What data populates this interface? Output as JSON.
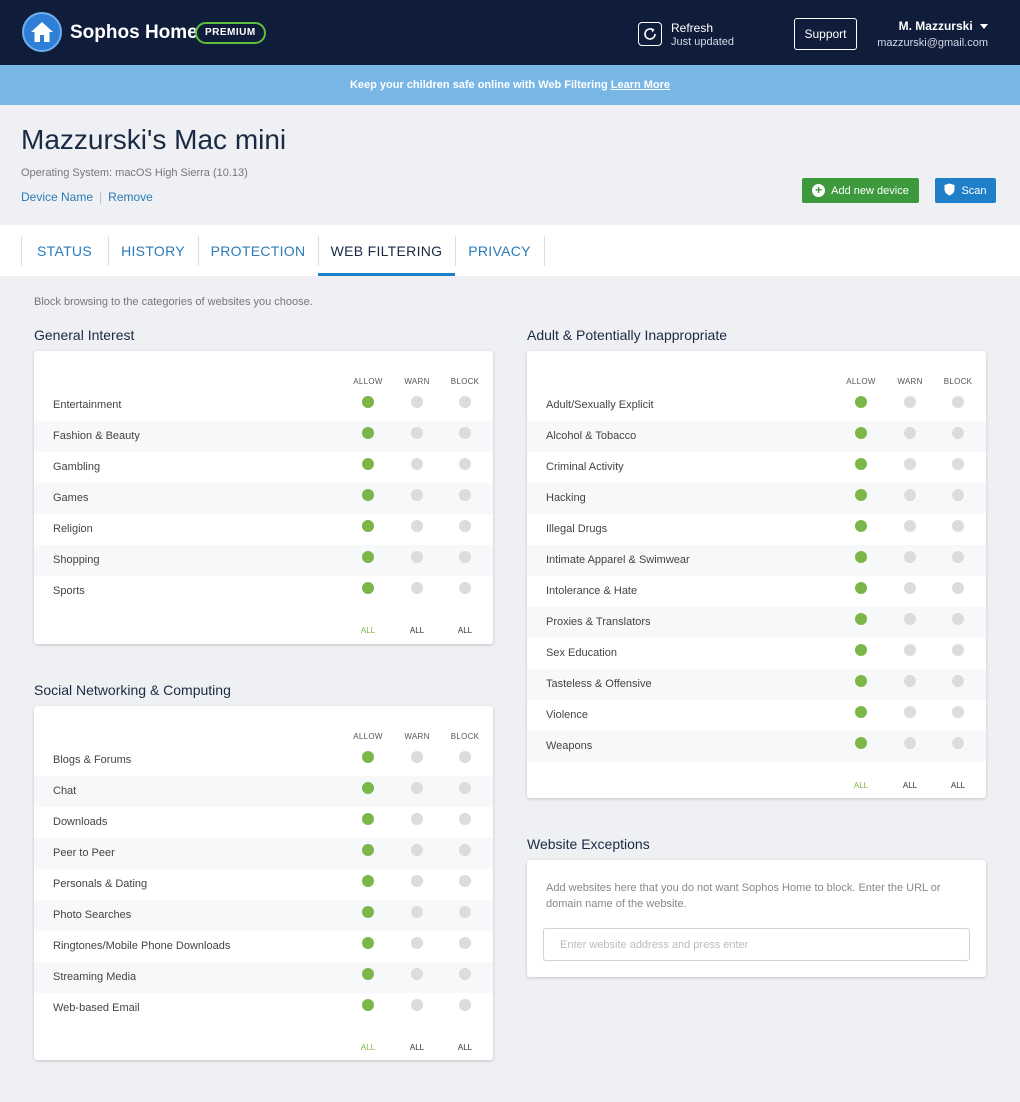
{
  "header": {
    "brand": "Sophos Home",
    "badge": "PREMIUM",
    "refresh_title": "Refresh",
    "refresh_status": "Just updated",
    "support_label": "Support",
    "user_name": "M. Mazzurski",
    "user_email": "mazzurski@gmail.com"
  },
  "banner": {
    "text": "Keep your children safe online with Web Filtering ",
    "link": "Learn More"
  },
  "device": {
    "title": "Mazzurski's Mac mini",
    "os": "Operating System: macOS High Sierra (10.13)",
    "name_link": "Device Name",
    "remove_link": "Remove",
    "add_label": "Add new device",
    "scan_label": "Scan"
  },
  "tabs": [
    "STATUS",
    "HISTORY",
    "PROTECTION",
    "WEB FILTERING",
    "PRIVACY"
  ],
  "active_tab": "WEB FILTERING",
  "intro": "Block browsing to the categories of websites you choose.",
  "columns": {
    "allow": "ALLOW",
    "warn": "WARN",
    "block": "BLOCK",
    "all": "ALL"
  },
  "groups": {
    "general": {
      "title": "General Interest",
      "items": [
        "Entertainment",
        "Fashion & Beauty",
        "Gambling",
        "Games",
        "Religion",
        "Shopping",
        "Sports"
      ]
    },
    "social": {
      "title": "Social Networking & Computing",
      "items": [
        "Blogs & Forums",
        "Chat",
        "Downloads",
        "Peer to Peer",
        "Personals & Dating",
        "Photo Searches",
        "Ringtones/Mobile Phone Downloads",
        "Streaming Media",
        "Web-based Email"
      ]
    },
    "adult": {
      "title": "Adult & Potentially Inappropriate",
      "items": [
        "Adult/Sexually Explicit",
        "Alcohol & Tobacco",
        "Criminal Activity",
        "Hacking",
        "Illegal Drugs",
        "Intimate Apparel & Swimwear",
        "Intolerance & Hate",
        "Proxies & Translators",
        "Sex Education",
        "Tasteless & Offensive",
        "Violence",
        "Weapons"
      ]
    }
  },
  "selected_setting": "ALLOW",
  "exceptions": {
    "title": "Website Exceptions",
    "description": "Add websites here that you do not want Sophos Home to block. Enter the URL or domain name of the website.",
    "placeholder": "Enter website address and press enter",
    "value": ""
  },
  "colors": {
    "header_bg": "#0f1c3a",
    "banner_bg": "#78b6e6",
    "allow_green": "#7ab648",
    "link_blue": "#2a7ab8",
    "add_green": "#3c9a3c",
    "scan_blue": "#1f7fc9"
  }
}
